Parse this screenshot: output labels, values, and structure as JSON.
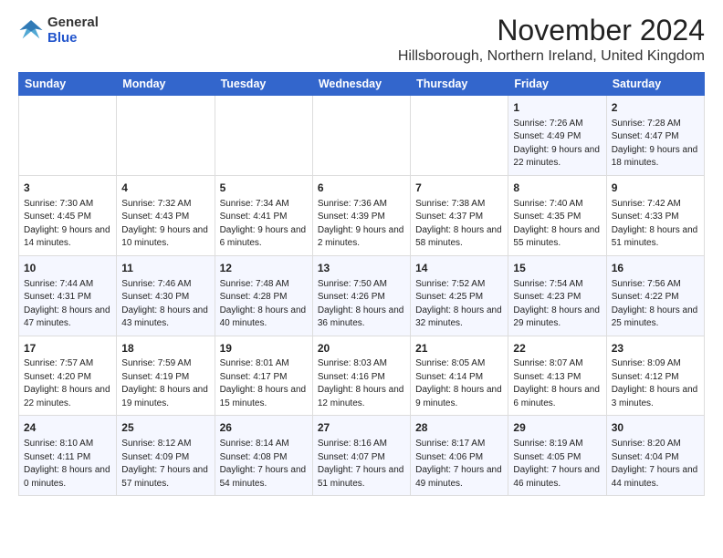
{
  "logo": {
    "general": "General",
    "blue": "Blue"
  },
  "title": "November 2024",
  "subtitle": "Hillsborough, Northern Ireland, United Kingdom",
  "days_header": [
    "Sunday",
    "Monday",
    "Tuesday",
    "Wednesday",
    "Thursday",
    "Friday",
    "Saturday"
  ],
  "weeks": [
    [
      {
        "day": "",
        "sunrise": "",
        "sunset": "",
        "daylight": ""
      },
      {
        "day": "",
        "sunrise": "",
        "sunset": "",
        "daylight": ""
      },
      {
        "day": "",
        "sunrise": "",
        "sunset": "",
        "daylight": ""
      },
      {
        "day": "",
        "sunrise": "",
        "sunset": "",
        "daylight": ""
      },
      {
        "day": "",
        "sunrise": "",
        "sunset": "",
        "daylight": ""
      },
      {
        "day": "1",
        "sunrise": "Sunrise: 7:26 AM",
        "sunset": "Sunset: 4:49 PM",
        "daylight": "Daylight: 9 hours and 22 minutes."
      },
      {
        "day": "2",
        "sunrise": "Sunrise: 7:28 AM",
        "sunset": "Sunset: 4:47 PM",
        "daylight": "Daylight: 9 hours and 18 minutes."
      }
    ],
    [
      {
        "day": "3",
        "sunrise": "Sunrise: 7:30 AM",
        "sunset": "Sunset: 4:45 PM",
        "daylight": "Daylight: 9 hours and 14 minutes."
      },
      {
        "day": "4",
        "sunrise": "Sunrise: 7:32 AM",
        "sunset": "Sunset: 4:43 PM",
        "daylight": "Daylight: 9 hours and 10 minutes."
      },
      {
        "day": "5",
        "sunrise": "Sunrise: 7:34 AM",
        "sunset": "Sunset: 4:41 PM",
        "daylight": "Daylight: 9 hours and 6 minutes."
      },
      {
        "day": "6",
        "sunrise": "Sunrise: 7:36 AM",
        "sunset": "Sunset: 4:39 PM",
        "daylight": "Daylight: 9 hours and 2 minutes."
      },
      {
        "day": "7",
        "sunrise": "Sunrise: 7:38 AM",
        "sunset": "Sunset: 4:37 PM",
        "daylight": "Daylight: 8 hours and 58 minutes."
      },
      {
        "day": "8",
        "sunrise": "Sunrise: 7:40 AM",
        "sunset": "Sunset: 4:35 PM",
        "daylight": "Daylight: 8 hours and 55 minutes."
      },
      {
        "day": "9",
        "sunrise": "Sunrise: 7:42 AM",
        "sunset": "Sunset: 4:33 PM",
        "daylight": "Daylight: 8 hours and 51 minutes."
      }
    ],
    [
      {
        "day": "10",
        "sunrise": "Sunrise: 7:44 AM",
        "sunset": "Sunset: 4:31 PM",
        "daylight": "Daylight: 8 hours and 47 minutes."
      },
      {
        "day": "11",
        "sunrise": "Sunrise: 7:46 AM",
        "sunset": "Sunset: 4:30 PM",
        "daylight": "Daylight: 8 hours and 43 minutes."
      },
      {
        "day": "12",
        "sunrise": "Sunrise: 7:48 AM",
        "sunset": "Sunset: 4:28 PM",
        "daylight": "Daylight: 8 hours and 40 minutes."
      },
      {
        "day": "13",
        "sunrise": "Sunrise: 7:50 AM",
        "sunset": "Sunset: 4:26 PM",
        "daylight": "Daylight: 8 hours and 36 minutes."
      },
      {
        "day": "14",
        "sunrise": "Sunrise: 7:52 AM",
        "sunset": "Sunset: 4:25 PM",
        "daylight": "Daylight: 8 hours and 32 minutes."
      },
      {
        "day": "15",
        "sunrise": "Sunrise: 7:54 AM",
        "sunset": "Sunset: 4:23 PM",
        "daylight": "Daylight: 8 hours and 29 minutes."
      },
      {
        "day": "16",
        "sunrise": "Sunrise: 7:56 AM",
        "sunset": "Sunset: 4:22 PM",
        "daylight": "Daylight: 8 hours and 25 minutes."
      }
    ],
    [
      {
        "day": "17",
        "sunrise": "Sunrise: 7:57 AM",
        "sunset": "Sunset: 4:20 PM",
        "daylight": "Daylight: 8 hours and 22 minutes."
      },
      {
        "day": "18",
        "sunrise": "Sunrise: 7:59 AM",
        "sunset": "Sunset: 4:19 PM",
        "daylight": "Daylight: 8 hours and 19 minutes."
      },
      {
        "day": "19",
        "sunrise": "Sunrise: 8:01 AM",
        "sunset": "Sunset: 4:17 PM",
        "daylight": "Daylight: 8 hours and 15 minutes."
      },
      {
        "day": "20",
        "sunrise": "Sunrise: 8:03 AM",
        "sunset": "Sunset: 4:16 PM",
        "daylight": "Daylight: 8 hours and 12 minutes."
      },
      {
        "day": "21",
        "sunrise": "Sunrise: 8:05 AM",
        "sunset": "Sunset: 4:14 PM",
        "daylight": "Daylight: 8 hours and 9 minutes."
      },
      {
        "day": "22",
        "sunrise": "Sunrise: 8:07 AM",
        "sunset": "Sunset: 4:13 PM",
        "daylight": "Daylight: 8 hours and 6 minutes."
      },
      {
        "day": "23",
        "sunrise": "Sunrise: 8:09 AM",
        "sunset": "Sunset: 4:12 PM",
        "daylight": "Daylight: 8 hours and 3 minutes."
      }
    ],
    [
      {
        "day": "24",
        "sunrise": "Sunrise: 8:10 AM",
        "sunset": "Sunset: 4:11 PM",
        "daylight": "Daylight: 8 hours and 0 minutes."
      },
      {
        "day": "25",
        "sunrise": "Sunrise: 8:12 AM",
        "sunset": "Sunset: 4:09 PM",
        "daylight": "Daylight: 7 hours and 57 minutes."
      },
      {
        "day": "26",
        "sunrise": "Sunrise: 8:14 AM",
        "sunset": "Sunset: 4:08 PM",
        "daylight": "Daylight: 7 hours and 54 minutes."
      },
      {
        "day": "27",
        "sunrise": "Sunrise: 8:16 AM",
        "sunset": "Sunset: 4:07 PM",
        "daylight": "Daylight: 7 hours and 51 minutes."
      },
      {
        "day": "28",
        "sunrise": "Sunrise: 8:17 AM",
        "sunset": "Sunset: 4:06 PM",
        "daylight": "Daylight: 7 hours and 49 minutes."
      },
      {
        "day": "29",
        "sunrise": "Sunrise: 8:19 AM",
        "sunset": "Sunset: 4:05 PM",
        "daylight": "Daylight: 7 hours and 46 minutes."
      },
      {
        "day": "30",
        "sunrise": "Sunrise: 8:20 AM",
        "sunset": "Sunset: 4:04 PM",
        "daylight": "Daylight: 7 hours and 44 minutes."
      }
    ]
  ]
}
